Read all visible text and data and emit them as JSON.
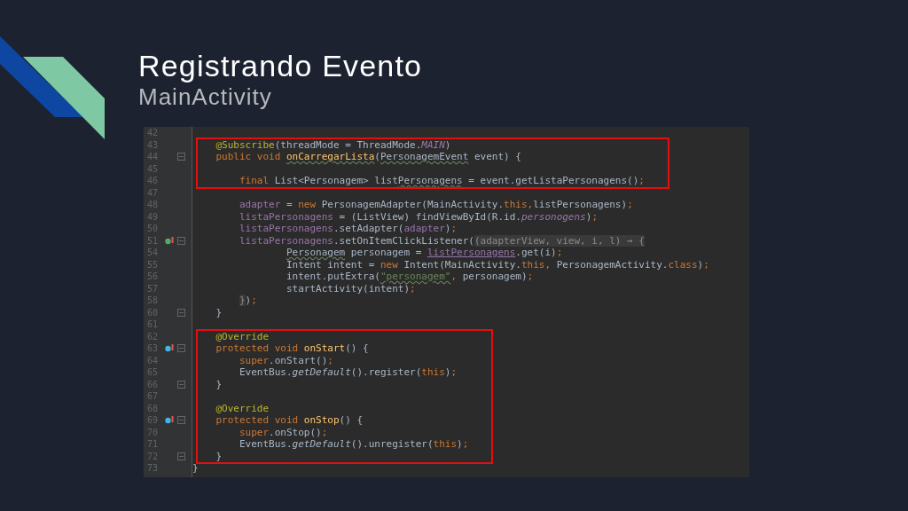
{
  "slide": {
    "title": "Registrando Evento",
    "subtitle": "MainActivity"
  },
  "editor": {
    "lines": [
      {
        "number": "42",
        "boxed": false,
        "fold": false
      },
      {
        "number": "43",
        "boxed": true,
        "fold": false,
        "tokens": [
          {
            "kind": "annotation",
            "text": "    @Subscribe"
          },
          {
            "kind": "plain",
            "text": "(threadMode = ThreadMode."
          },
          {
            "kind": "constant",
            "text": "MAIN"
          },
          {
            "kind": "plain",
            "text": ")"
          }
        ]
      },
      {
        "number": "44",
        "boxed": true,
        "fold": true,
        "tokens": [
          {
            "kind": "keyword",
            "text": "    public void "
          },
          {
            "kind": "method_warn",
            "text": "onCarregarLista"
          },
          {
            "kind": "plain",
            "text": "("
          },
          {
            "kind": "warn",
            "text": "PersonagemEvent"
          },
          {
            "kind": "plain",
            "text": " event) {"
          }
        ]
      },
      {
        "number": "45",
        "boxed": true,
        "fold": false
      },
      {
        "number": "46",
        "boxed": true,
        "fold": false,
        "tokens": [
          {
            "kind": "keyword",
            "text": "        final "
          },
          {
            "kind": "plain",
            "text": "List<Personagem> list"
          },
          {
            "kind": "warn",
            "text": "Personagens"
          },
          {
            "kind": "plain",
            "text": " = event.getListaPersonagens()"
          },
          {
            "kind": "keyword",
            "text": ";"
          }
        ]
      },
      {
        "number": "47",
        "boxed": false,
        "fold": false
      },
      {
        "number": "48",
        "boxed": false,
        "fold": false,
        "tokens": [
          {
            "kind": "field",
            "text": "        adapter"
          },
          {
            "kind": "plain",
            "text": " = "
          },
          {
            "kind": "keyword",
            "text": "new "
          },
          {
            "kind": "plain",
            "text": "PersonagemAdapter(MainActivity."
          },
          {
            "kind": "keyword",
            "text": "this,"
          },
          {
            "kind": "plain",
            "text": "listPersonagens)"
          },
          {
            "kind": "keyword",
            "text": ";"
          }
        ]
      },
      {
        "number": "49",
        "boxed": false,
        "fold": false,
        "tokens": [
          {
            "kind": "field",
            "text": "        listaPersonagens"
          },
          {
            "kind": "plain",
            "text": " = (ListView) findViewById(R.id."
          },
          {
            "kind": "constant",
            "text": "personogens"
          },
          {
            "kind": "plain",
            "text": ")"
          },
          {
            "kind": "keyword",
            "text": ";"
          }
        ]
      },
      {
        "number": "50",
        "boxed": false,
        "fold": false,
        "tokens": [
          {
            "kind": "field",
            "text": "        listaPersonagens"
          },
          {
            "kind": "plain",
            "text": ".setAdapter("
          },
          {
            "kind": "field",
            "text": "adapter"
          },
          {
            "kind": "plain",
            "text": ")"
          },
          {
            "kind": "keyword",
            "text": ";"
          }
        ]
      },
      {
        "number": "51",
        "boxed": false,
        "fold": true,
        "marker": {
          "kind": "lambda"
        },
        "tokens": [
          {
            "kind": "field",
            "text": "        listaPersonagens"
          },
          {
            "kind": "plain",
            "text": ".setOnItemClickListener("
          },
          {
            "kind": "folded",
            "text": "(adapterView, view, i, l) → {"
          }
        ]
      },
      {
        "number": "54",
        "boxed": false,
        "fold": false,
        "tokens": [
          {
            "kind": "warn",
            "text": "                Personagem"
          },
          {
            "kind": "plain",
            "text": " personagem = "
          },
          {
            "kind": "field_link",
            "text": "listPersonagens"
          },
          {
            "kind": "plain",
            "text": ".get(i)"
          },
          {
            "kind": "keyword",
            "text": ";"
          }
        ]
      },
      {
        "number": "55",
        "boxed": false,
        "fold": false,
        "tokens": [
          {
            "kind": "plain",
            "text": "                Intent intent = "
          },
          {
            "kind": "keyword",
            "text": "new "
          },
          {
            "kind": "plain",
            "text": "Intent(MainActivity."
          },
          {
            "kind": "keyword",
            "text": "this, "
          },
          {
            "kind": "plain",
            "text": "PersonagemActivity."
          },
          {
            "kind": "keyword",
            "text": "class"
          },
          {
            "kind": "plain",
            "text": ")"
          },
          {
            "kind": "keyword",
            "text": ";"
          }
        ]
      },
      {
        "number": "56",
        "boxed": false,
        "fold": false,
        "tokens": [
          {
            "kind": "plain",
            "text": "                intent.putExtra("
          },
          {
            "kind": "string",
            "text": "\"personagem\""
          },
          {
            "kind": "keyword",
            "text": ", "
          },
          {
            "kind": "plain",
            "text": "personagem)"
          },
          {
            "kind": "keyword",
            "text": ";"
          }
        ]
      },
      {
        "number": "57",
        "boxed": false,
        "fold": false,
        "tokens": [
          {
            "kind": "plain",
            "text": "                startActivity(intent)"
          },
          {
            "kind": "keyword",
            "text": ";"
          }
        ]
      },
      {
        "number": "58",
        "boxed": false,
        "fold": false,
        "tokens": [
          {
            "kind": "folded",
            "text": "        }"
          },
          {
            "kind": "plain",
            "text": ")"
          },
          {
            "kind": "keyword",
            "text": ";"
          }
        ]
      },
      {
        "number": "60",
        "boxed": false,
        "fold": true,
        "tokens": [
          {
            "kind": "plain",
            "text": "    }"
          }
        ]
      },
      {
        "number": "61",
        "boxed": false,
        "fold": false
      },
      {
        "number": "62",
        "boxed": true,
        "fold": false,
        "tokens": [
          {
            "kind": "annotation",
            "text": "    @Override"
          }
        ]
      },
      {
        "number": "63",
        "boxed": true,
        "fold": true,
        "marker": {
          "kind": "override"
        },
        "tokens": [
          {
            "kind": "keyword",
            "text": "    protected void "
          },
          {
            "kind": "method",
            "text": "onStart"
          },
          {
            "kind": "plain",
            "text": "() {"
          }
        ]
      },
      {
        "number": "64",
        "boxed": true,
        "fold": false,
        "tokens": [
          {
            "kind": "keyword",
            "text": "        super"
          },
          {
            "kind": "plain",
            "text": ".onStart()"
          },
          {
            "kind": "keyword",
            "text": ";"
          }
        ]
      },
      {
        "number": "65",
        "boxed": true,
        "fold": false,
        "tokens": [
          {
            "kind": "plain",
            "text": "        EventBus."
          },
          {
            "kind": "italic",
            "text": "getDefault"
          },
          {
            "kind": "plain",
            "text": "().register("
          },
          {
            "kind": "keyword",
            "text": "this"
          },
          {
            "kind": "plain",
            "text": ")"
          },
          {
            "kind": "keyword",
            "text": ";"
          }
        ]
      },
      {
        "number": "66",
        "boxed": true,
        "fold": true,
        "tokens": [
          {
            "kind": "plain",
            "text": "    }"
          }
        ]
      },
      {
        "number": "67",
        "boxed": true,
        "fold": false
      },
      {
        "number": "68",
        "boxed": true,
        "fold": false,
        "tokens": [
          {
            "kind": "annotation",
            "text": "    @Override"
          }
        ]
      },
      {
        "number": "69",
        "boxed": true,
        "fold": true,
        "marker": {
          "kind": "override"
        },
        "tokens": [
          {
            "kind": "keyword",
            "text": "    protected void "
          },
          {
            "kind": "method",
            "text": "onStop"
          },
          {
            "kind": "plain",
            "text": "() {"
          }
        ]
      },
      {
        "number": "70",
        "boxed": true,
        "fold": false,
        "tokens": [
          {
            "kind": "keyword",
            "text": "        super"
          },
          {
            "kind": "plain",
            "text": ".onStop()"
          },
          {
            "kind": "keyword",
            "text": ";"
          }
        ]
      },
      {
        "number": "71",
        "boxed": true,
        "fold": false,
        "tokens": [
          {
            "kind": "plain",
            "text": "        EventBus."
          },
          {
            "kind": "italic",
            "text": "getDefault"
          },
          {
            "kind": "plain",
            "text": "().unregister("
          },
          {
            "kind": "keyword",
            "text": "this"
          },
          {
            "kind": "plain",
            "text": ")"
          },
          {
            "kind": "keyword",
            "text": ";"
          }
        ]
      },
      {
        "number": "72",
        "boxed": true,
        "fold": true,
        "tokens": [
          {
            "kind": "plain",
            "text": "    }"
          }
        ]
      },
      {
        "number": "73",
        "boxed": false,
        "fold": false,
        "tokens": [
          {
            "kind": "plain",
            "text": "}"
          }
        ]
      }
    ]
  }
}
